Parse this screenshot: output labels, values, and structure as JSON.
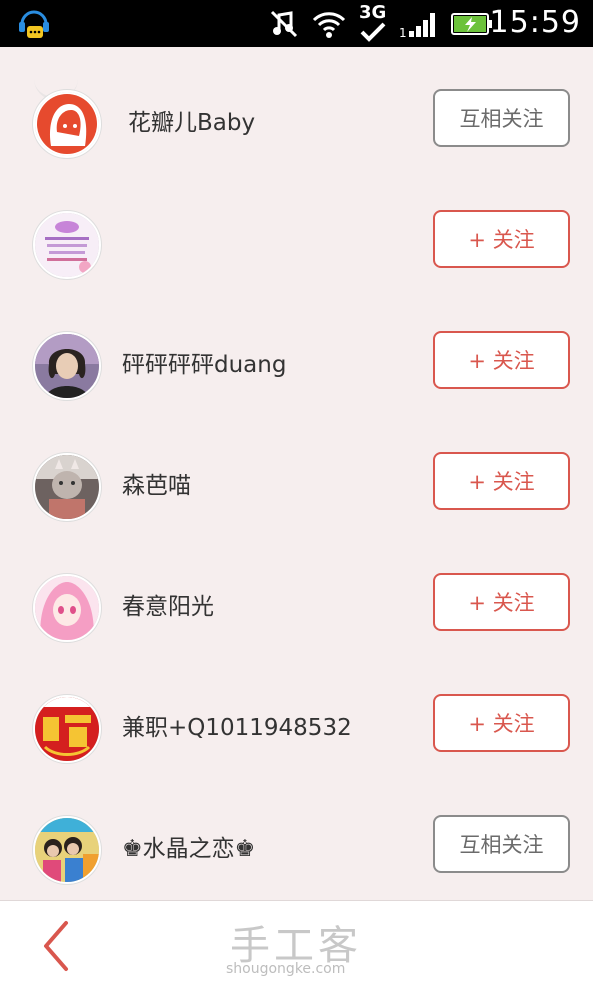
{
  "status_bar": {
    "network": "3G",
    "time": "15:59",
    "icons": [
      "app-notify-icon",
      "music-muted-icon",
      "wifi-icon",
      "3g-icon",
      "signal-icon",
      "battery-charging-icon"
    ]
  },
  "users": [
    {
      "name": "花瓣儿Baby",
      "button": "互相关注",
      "state": "mutual",
      "avatar": "avatar-red-girl"
    },
    {
      "name": "",
      "button": "+ 关注",
      "state": "follow",
      "avatar": "avatar-pink-card"
    },
    {
      "name": "砰砰砰砰duang",
      "button": "+ 关注",
      "state": "follow",
      "avatar": "avatar-person-photo"
    },
    {
      "name": "森芭喵",
      "button": "+ 关注",
      "state": "follow",
      "avatar": "avatar-cat-photo"
    },
    {
      "name": "春意阳光",
      "button": "+ 关注",
      "state": "follow",
      "avatar": "avatar-anime-pink"
    },
    {
      "name": "兼职+Q1011948532",
      "button": "+ 关注",
      "state": "follow",
      "avatar": "avatar-red-logo"
    },
    {
      "name": "♚水晶之恋♚",
      "button": "互相关注",
      "state": "mutual",
      "avatar": "avatar-group-photo"
    }
  ],
  "bottom_bar": {
    "back_icon": "chevron-left-icon",
    "logo_text": "手工客",
    "logo_url": "shougongke.com"
  },
  "colors": {
    "accent": "#d9574e",
    "mutual_border": "#8b8b8b",
    "background": "#f6eeee"
  }
}
